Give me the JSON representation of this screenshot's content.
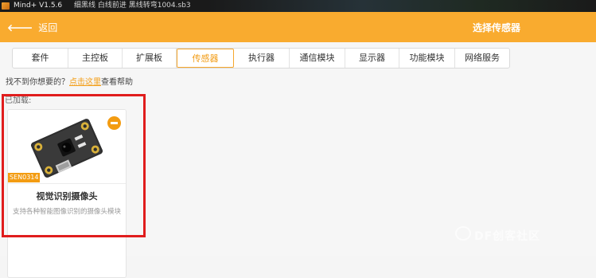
{
  "window": {
    "app_name": "Mind+ V1.5.6",
    "file_name": "细黑线 白线前进 黑线转弯1004.sb3"
  },
  "header": {
    "back_label": "返回",
    "title": "选择传感器",
    "accent_color": "#f9ab2f"
  },
  "tabs": [
    {
      "label": "套件",
      "active": false
    },
    {
      "label": "主控板",
      "active": false
    },
    {
      "label": "扩展板",
      "active": false
    },
    {
      "label": "传感器",
      "active": true
    },
    {
      "label": "执行器",
      "active": false
    },
    {
      "label": "通信模块",
      "active": false
    },
    {
      "label": "显示器",
      "active": false
    },
    {
      "label": "功能模块",
      "active": false
    },
    {
      "label": "网络服务",
      "active": false
    }
  ],
  "help": {
    "prefix": "找不到你想要的？",
    "link": "点击这里",
    "suffix": "查看帮助"
  },
  "loaded_label": "已加载:",
  "card": {
    "sku": "SEN0314",
    "name": "视觉识别摄像头",
    "description": "支持各种智能图像识别的摄像头模块",
    "remove_icon": "minus-circle-icon"
  },
  "watermark": "DF创客社区"
}
